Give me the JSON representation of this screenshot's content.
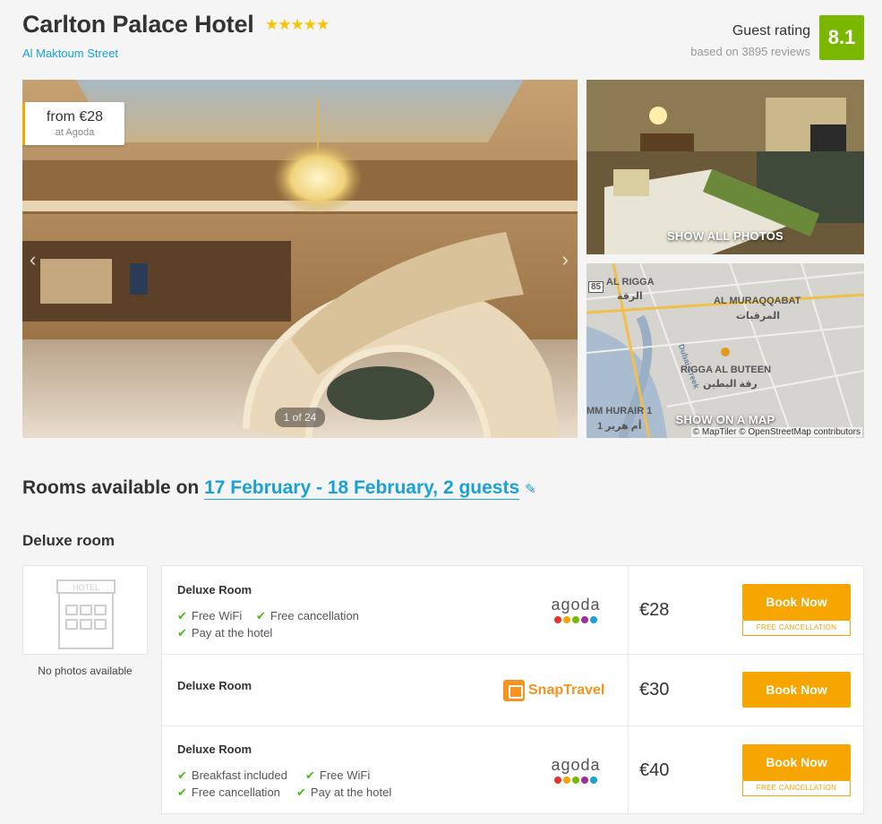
{
  "hotel": {
    "name": "Carlton Palace Hotel",
    "stars": "★★★★★",
    "address": "Al Maktoum Street"
  },
  "rating": {
    "title": "Guest rating",
    "reviews": "based on 3895 reviews",
    "score": "8.1",
    "score_color": "#7ab800"
  },
  "gallery": {
    "price_from": "from €28",
    "price_source": "at Agoda",
    "counter": "1 of 24",
    "prev_arrow": "‹",
    "next_arrow": "›",
    "show_photos_label": "SHOW ALL PHOTOS",
    "show_map_label": "SHOW ON A MAP",
    "map_attribution": "© MapTiler © OpenStreetMap contributors",
    "map_labels": {
      "al_rigga": "AL RIGGA",
      "al_rigga_ar": "الرقة",
      "al_muraqqabat": "AL MURAQQABAT",
      "al_muraqqabat_ar": "المرقبات",
      "rigga_al_buteen": "RIGGA AL BUTEEN",
      "rigga_al_buteen_ar": "رقة البطين",
      "umm_hurair": "MM HURAIR 1",
      "umm_hurair_ar": "أم هرير 1",
      "road_85": "85",
      "creek": "Dubai Creek"
    }
  },
  "rooms": {
    "heading_prefix": "Rooms available on ",
    "dates": "17 February - 18 February, 2 guests",
    "edit_icon": "✎",
    "room_type": "Deluxe room",
    "no_photos": "No photos available",
    "no_photos_sign": "HOTEL"
  },
  "offers": [
    {
      "name": "Deluxe Room",
      "amenities": [
        "Free WiFi",
        "Free cancellation",
        "Pay at the hotel"
      ],
      "provider": "agoda",
      "price": "€28",
      "button": "Book Now",
      "cancel_badge": "FREE CANCELLATION"
    },
    {
      "name": "Deluxe Room",
      "amenities": [],
      "provider": "SnapTravel",
      "price": "€30",
      "button": "Book Now"
    },
    {
      "name": "Deluxe Room",
      "amenities": [
        "Breakfast included",
        "Free WiFi",
        "Free cancellation",
        "Pay at the hotel"
      ],
      "provider": "agoda",
      "price": "€40",
      "button": "Book Now",
      "cancel_badge": "FREE CANCELLATION"
    }
  ],
  "check_icon": "✔",
  "colors": {
    "accent_blue": "#1aa1d6",
    "book_orange": "#f7a500",
    "check_green": "#4cbb17",
    "agoda_dots": [
      "#e8312f",
      "#f7a500",
      "#7ab800",
      "#9c2f9b",
      "#1aa1d6"
    ]
  }
}
